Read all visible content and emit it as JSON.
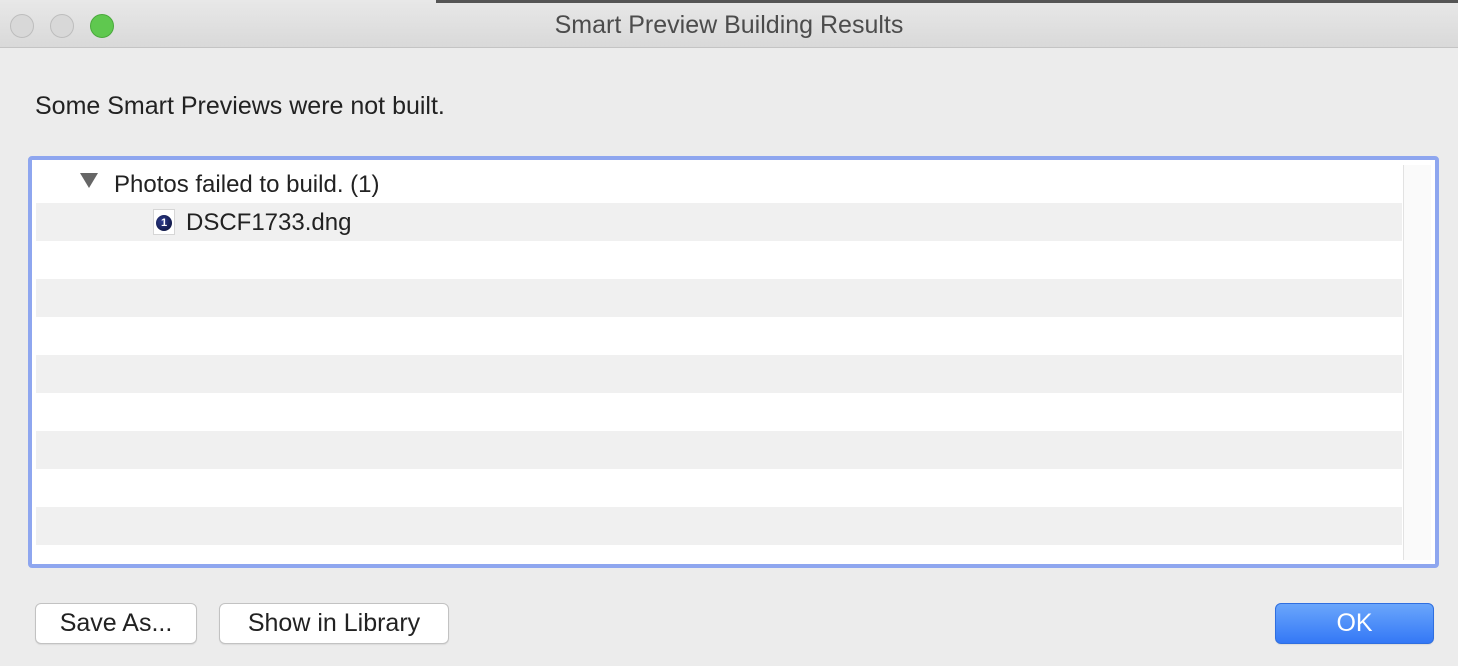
{
  "window": {
    "title": "Smart Preview Building Results"
  },
  "message": "Some Smart Previews were not built.",
  "results": {
    "group": {
      "label": "Photos failed to build. (1)",
      "expanded": true
    },
    "files": [
      {
        "name": "DSCF1733.dng",
        "icon": "capture-one-file-icon",
        "badge": "1"
      }
    ]
  },
  "buttons": {
    "save_as": "Save As...",
    "show_in_library": "Show in Library",
    "ok": "OK"
  },
  "colors": {
    "accent": "#3478f6",
    "focus_ring": "#8ea6ef",
    "zoom_button": "#5fc84f"
  }
}
